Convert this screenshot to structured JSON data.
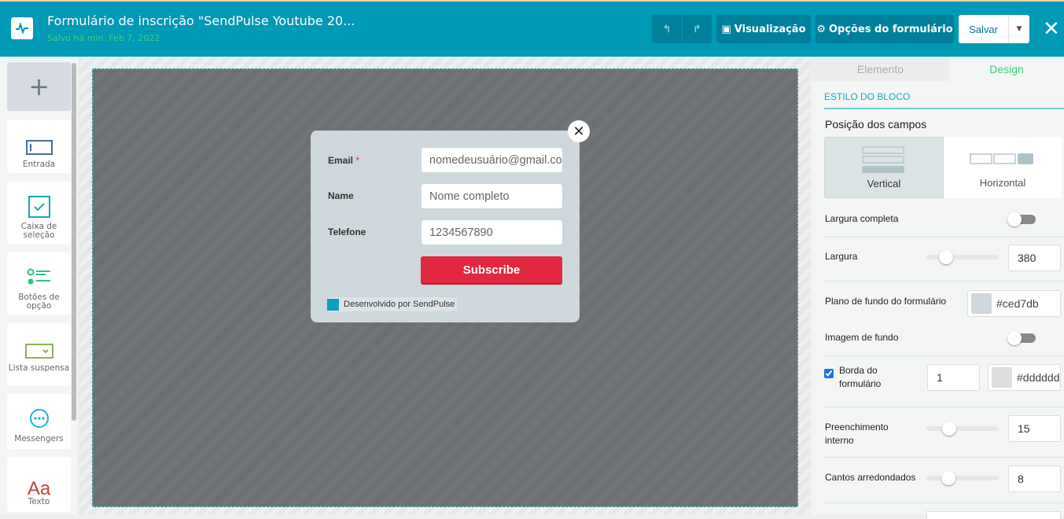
{
  "header": {
    "title": "Formulário de inscrição \"SendPulse Youtube 20...",
    "saved": "Salvo há min. Feb 7, 2022",
    "preview": "Visualização",
    "options": "Opções do formulário",
    "save": "Salvar"
  },
  "sidebar": {
    "items": [
      {
        "label": "Entrada"
      },
      {
        "label": "Caixa de seleção"
      },
      {
        "label": "Botões de opção"
      },
      {
        "label": "Lista suspensa"
      },
      {
        "label": "Messengers"
      },
      {
        "label": "Texto"
      }
    ],
    "text_icon": "Aa"
  },
  "form": {
    "fields": [
      {
        "label": "Email",
        "required": "*",
        "value": "nomedeusuário@gmail.com"
      },
      {
        "label": "Name",
        "value": "Nome completo"
      },
      {
        "label": "Telefone",
        "value": "1234567890"
      }
    ],
    "submit": "Subscribe",
    "powered": "Desenvolvido por SendPulse",
    "background": "#ced7db",
    "submit_color": "#e2283f"
  },
  "panel": {
    "tabs": [
      {
        "label": "Elemento"
      },
      {
        "label": "Design"
      }
    ],
    "section": "ESTILO DO BLOCO",
    "position_label": "Posição dos campos",
    "positions": [
      {
        "label": "Vertical",
        "selected": true
      },
      {
        "label": "Horizontal",
        "selected": false
      }
    ],
    "full_width": {
      "label": "Largura completa",
      "on": false
    },
    "width": {
      "label": "Largura",
      "value": "380"
    },
    "bg": {
      "label": "Plano de fundo do formulário",
      "value": "#ced7db"
    },
    "bg_image": {
      "label": "Imagem de fundo",
      "on": false
    },
    "border": {
      "label": "Borda do formulário",
      "checked": true,
      "width": "1",
      "color": "#dddddd"
    },
    "padding": {
      "label": "Preenchimento interno",
      "value": "15"
    },
    "radius": {
      "label": "Cantos arredondados",
      "value": "8"
    }
  },
  "colors": {
    "header": "#0099b6",
    "accent": "#3fcf7a"
  }
}
